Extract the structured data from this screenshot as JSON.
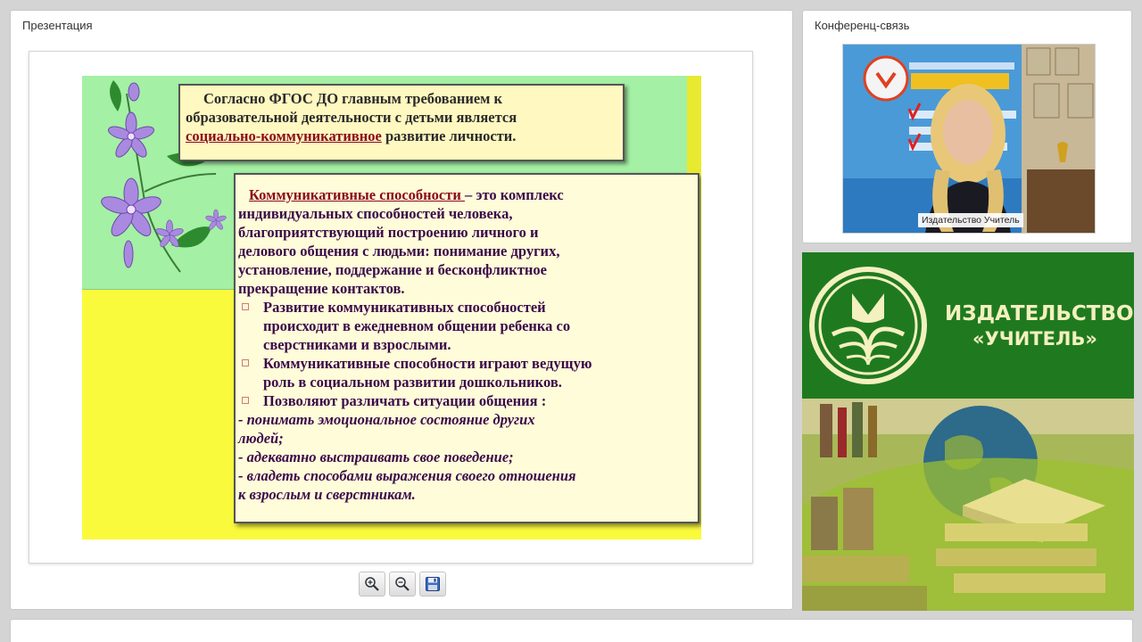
{
  "presentation": {
    "panel_title": "Презентация",
    "slide": {
      "top_box": {
        "line1": "Согласно ФГОС ДО  главным требованием  к",
        "line2": "образовательной деятельности с детьми является",
        "underlined": "социально-коммуникативное",
        "line3_rest": " развитие личности."
      },
      "main_box": {
        "term": "Коммуникативные способности ",
        "intro_line1_rest": "– это комплекс",
        "intro_lines": [
          "индивидуальных способностей человека,",
          "благоприятствующий построению личного и",
          "делового общения с людьми: понимание других,",
          "установление, поддержание и бесконфликтное",
          "прекращение контактов."
        ],
        "bullets": [
          [
            "Развитие коммуникативных способностей",
            "происходит в ежедневном общении  ребенка со",
            "сверстниками и взрослыми."
          ],
          [
            "Коммуникативные  способности играют ведущую",
            "роль в социальном развитии дошкольников."
          ],
          [
            " Позволяют различать  ситуации общения :"
          ]
        ],
        "italic_lines": [
          "- понимать  эмоциональное состояние  других",
          "людей;",
          "- адекватно выстраивать свое поведение;",
          "- владеть способами выражения своего отношения",
          "к взрослым и сверстникам."
        ]
      }
    },
    "toolbar": {
      "zoom_in_icon": "zoom-in-icon",
      "zoom_out_icon": "zoom-out-icon",
      "save_icon": "floppy-disk-icon"
    }
  },
  "conference": {
    "panel_title": "Конференц-связь",
    "video_caption": "Издательство Учитель"
  },
  "publisher": {
    "name_line1": "ИЗДАТЕЛЬСТВО",
    "name_line2": "«УЧИТЕЛЬ»"
  },
  "colors": {
    "slide_yellow": "#fafa3c",
    "slide_green": "#a4f0a4",
    "publisher_green": "#1f7a1f",
    "publisher_text": "#f4f0c0",
    "term_red": "#8b0a1a",
    "text_purple": "#3a0a4a"
  }
}
